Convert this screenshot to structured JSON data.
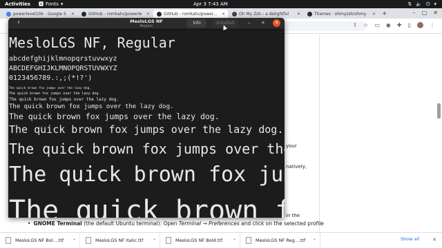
{
  "topbar": {
    "activities": "Activities",
    "app_name": "Fonts",
    "clock": "Apr 3   7:43 AM"
  },
  "browser": {
    "tabs": [
      {
        "title": "powerlevel10k - Google S",
        "fav_color": "#4285f4"
      },
      {
        "title": "GitHub - romkatv/powerle",
        "fav_color": "#24292e"
      },
      {
        "title": "GitHub - romkatv/power...",
        "fav_color": "#24292e"
      },
      {
        "title": "Oh My Zsh - a delightful",
        "fav_color": "#444"
      },
      {
        "title": "Themes · ohmyzsh/ohmy",
        "fav_color": "#24292e"
      }
    ],
    "new_tab": "+",
    "page_fragments": {
      "your": "your",
      "natively": "natively,",
      "in_the": "in the"
    },
    "gnome_line": {
      "bold": "GNOME Terminal",
      "rest": " (the default Ubuntu terminal): Open ",
      "italic": "Terminal → Preferences",
      "tail": " and click on the selected profile"
    }
  },
  "downloads": {
    "items": [
      {
        "name": "MesloLGS NF Bol....ttf"
      },
      {
        "name": "MesloLGS NF Italic.ttf"
      },
      {
        "name": "MesloLGS NF Bold.ttf"
      },
      {
        "name": "MesloLGS NF Reg....ttf"
      }
    ],
    "show_all": "Show all"
  },
  "font_viewer": {
    "title": "MesloLGS NF",
    "subtitle": "Regular",
    "info_label": "Info",
    "installed_label": "Installed",
    "preview": {
      "name": "MesloLGS NF, Regular",
      "lowercase": "abcdefghijklmnopqrstuvwxyz",
      "uppercase": "ABCDEFGHIJKLMNOPQRSTUVWXYZ",
      "digits": "0123456789.:,;(*!?')",
      "sample": "The quick brown fox jumps over the lazy dog."
    }
  }
}
